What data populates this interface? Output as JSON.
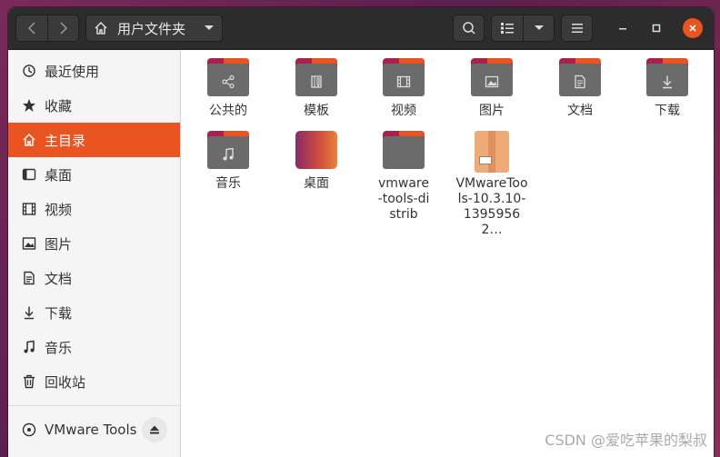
{
  "header": {
    "back_icon": "chevron-left-icon",
    "forward_icon": "chevron-right-icon",
    "path_label": "用户文件夹",
    "path_icon": "home-icon",
    "search_icon": "search-icon",
    "view_icon": "list-view-icon",
    "view_options_icon": "chevron-down-icon",
    "menu_icon": "hamburger-menu-icon",
    "minimize_icon": "minimize-icon",
    "maximize_icon": "maximize-icon",
    "close_icon": "close-icon",
    "accent": "#e95420"
  },
  "sidebar": {
    "items": [
      {
        "label": "最近使用",
        "icon": "recent-clock-icon"
      },
      {
        "label": "收藏",
        "icon": "star-icon"
      },
      {
        "label": "主目录",
        "icon": "home-icon",
        "active": true
      },
      {
        "label": "桌面",
        "icon": "desktop-icon"
      },
      {
        "label": "视频",
        "icon": "film-icon"
      },
      {
        "label": "图片",
        "icon": "picture-icon"
      },
      {
        "label": "文档",
        "icon": "document-icon"
      },
      {
        "label": "下载",
        "icon": "download-icon"
      },
      {
        "label": "音乐",
        "icon": "music-icon"
      },
      {
        "label": "回收站",
        "icon": "trash-icon"
      }
    ],
    "device": {
      "label": "VMware Tools",
      "icon": "disc-icon",
      "action_icon": "eject-icon"
    }
  },
  "files": [
    {
      "name": "公共的",
      "icon": "share-icon",
      "kind": "folder"
    },
    {
      "name": "模板",
      "icon": "template-icon",
      "kind": "folder"
    },
    {
      "name": "视频",
      "icon": "film-icon",
      "kind": "folder"
    },
    {
      "name": "图片",
      "icon": "picture-icon",
      "kind": "folder"
    },
    {
      "name": "文档",
      "icon": "document-icon",
      "kind": "folder"
    },
    {
      "name": "下载",
      "icon": "download-icon",
      "kind": "folder"
    },
    {
      "name": "音乐",
      "icon": "music-icon",
      "kind": "folder"
    },
    {
      "name": "桌面",
      "icon": "desktop-icon",
      "kind": "desktop-folder"
    },
    {
      "name": "vmware-tools-distrib",
      "icon": "folder-icon",
      "kind": "folder"
    },
    {
      "name": "VMwareTools-10.3.10-13959562…",
      "icon": "archive-icon",
      "kind": "archive"
    }
  ],
  "watermark": "CSDN @爱吃苹果的梨叔"
}
